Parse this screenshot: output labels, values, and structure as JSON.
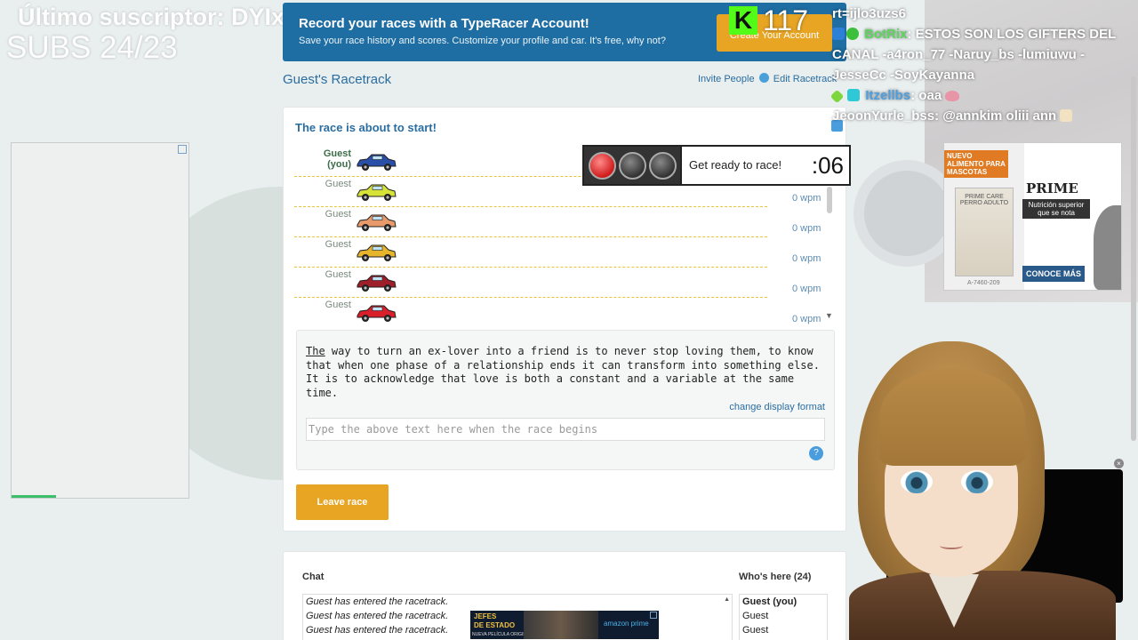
{
  "overlay": {
    "last_sub": "Último suscriptor: DYIxkick",
    "subs": "SUBS 24/23",
    "kick_count": "117",
    "kick_logo": "K"
  },
  "banner": {
    "title": "Record your races with a TypeRacer Account!",
    "subtitle": "Save your race history and scores. Customize your profile and car. It's free, why not?",
    "button": "Create Your Account"
  },
  "track": {
    "title": "Guest's Racetrack",
    "invite": "Invite People",
    "edit": "Edit Racetrack"
  },
  "race": {
    "status": "The race is about to start!",
    "countdown_text": "Get ready to race!",
    "timer": ":06",
    "racers": [
      {
        "name": "Guest",
        "sub": "(you)",
        "wpm": "",
        "color": "#2a4fa8"
      },
      {
        "name": "Guest",
        "sub": "",
        "wpm": "0 wpm",
        "color": "#d8e33a"
      },
      {
        "name": "Guest",
        "sub": "",
        "wpm": "0 wpm",
        "color": "#e89a6a"
      },
      {
        "name": "Guest",
        "sub": "",
        "wpm": "0 wpm",
        "color": "#e6b52c"
      },
      {
        "name": "Guest",
        "sub": "",
        "wpm": "0 wpm",
        "color": "#9e1e2a"
      },
      {
        "name": "Guest",
        "sub": "",
        "wpm": "0 wpm",
        "color": "#d81f2a"
      }
    ],
    "text_first_word": "The",
    "text_rest": " way to turn an ex-lover into a friend is to never stop loving them, to know that when one phase of a relationship ends it can transform into something else. It is to acknowledge that love is both a constant and a variable at the same time.",
    "change_format": "change display format",
    "input_placeholder": "Type the above text here when the race begins",
    "input_value": "",
    "leave_button": "Leave race"
  },
  "chat": {
    "title": "Chat",
    "messages": [
      "Guest has entered the racetrack.",
      "Guest has entered the racetrack.",
      "Guest has entered the racetrack."
    ],
    "who_title": "Who's here (24)",
    "who": [
      "Guest (you)",
      "Guest",
      "Guest"
    ]
  },
  "ads": {
    "right_tag": "NUEVO ALIMENTO PARA MASCOTAS",
    "right_brand": "PRIME CARE.",
    "right_slogan": "Nutrición superior que se nota",
    "right_cta": "CONOCE MÁS",
    "right_bag": "PRIME CARE PERRO ADULTO",
    "right_sku": "A-7460-209",
    "bottom_title_1": "JEFES",
    "bottom_title_2": "DE ESTADO",
    "bottom_sub": "NUEVA PELÍCULA ORIGINAL YA AHORA",
    "bottom_brand": "amazon prime"
  },
  "stream_chat": {
    "line1": "rt=ijlo3uzs6",
    "line2_user": "BotRix",
    "line2_text": ": ESTOS SON LOS GIFTERS DEL CANAL -a4ron_77 -Naruy_bs -lumiuwu -JesseCc -SoyKayanna",
    "line3_user": "Itzellbs",
    "line3_text": ": oaa",
    "line4_user": "JeoonYurle_bss",
    "line4_text": ": @annkim oliii ann"
  },
  "colors": {
    "accent_blue": "#2a6da0",
    "banner_blue": "#1f6ea3",
    "orange": "#e8a524",
    "lane_dash": "#e8c43a"
  }
}
